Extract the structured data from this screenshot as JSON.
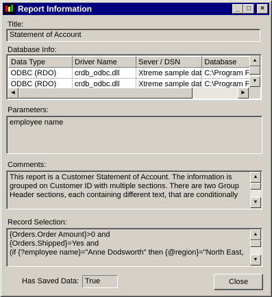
{
  "window": {
    "title": "Report Information",
    "buttons": {
      "minimize": "_",
      "maximize": "□",
      "close": "×"
    }
  },
  "title_field": {
    "label": "Title:",
    "value": "Statement of Account"
  },
  "database_info": {
    "label": "Database Info:",
    "columns": [
      "Data Type",
      "Driver Name",
      "Sever / DSN",
      "Database"
    ],
    "rows": [
      [
        "ODBC (RDO)",
        "crdb_odbc.dll",
        "Xtreme sample dat",
        "C:\\Program File"
      ],
      [
        "ODBC (RDO)",
        "crdb_odbc.dll",
        "Xtreme sample dat",
        "C:\\Program File"
      ]
    ]
  },
  "parameters": {
    "label": "Parameters:",
    "value": "employee name"
  },
  "comments": {
    "label": "Comments:",
    "value": "This report is a Customer Statement of Account.  The information is grouped on Customer ID with multiple sections.  There are two Group Header sections, each containing different text, that are conditionally"
  },
  "record_selection": {
    "label": "Record Selection:",
    "lines": [
      "{Orders.Order Amount}>0 and",
      "{Orders.Shipped}=Yes and",
      "(if {?employee name}=\"Anne Dodsworth\" then {@region}=\"North East,"
    ]
  },
  "saved_data": {
    "label": "Has Saved Data:",
    "value": "True"
  },
  "close_button": {
    "label": "Close"
  },
  "icons": [
    "app-icon",
    "scroll-up-arrow-icon",
    "scroll-down-arrow-icon",
    "scroll-left-arrow-icon",
    "scroll-right-arrow-icon"
  ],
  "colors": {
    "titlebar": "#000080",
    "face": "#d4d0c8"
  }
}
